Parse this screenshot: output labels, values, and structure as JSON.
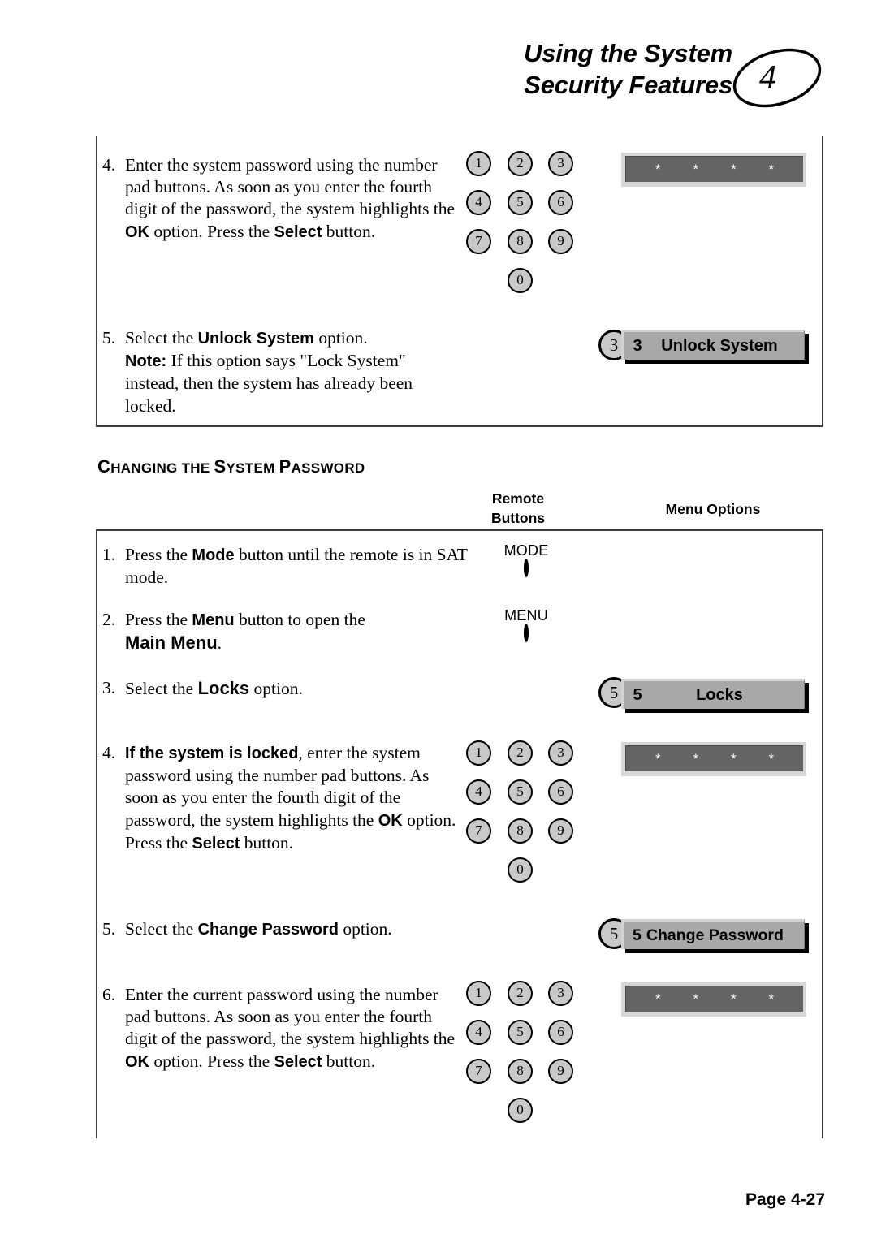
{
  "header": {
    "title_line1": "Using the System",
    "title_line2": "Security Features",
    "chapter_number": "4"
  },
  "section": {
    "heading_parts": [
      "C",
      "HANGING THE ",
      "S",
      "YSTEM ",
      "P",
      "ASSWORD"
    ],
    "heading_full": "CHANGING THE SYSTEM PASSWORD"
  },
  "column_headers": {
    "remote_line1": "Remote",
    "remote_line2": "Buttons",
    "menu": "Menu Options"
  },
  "keypad": {
    "row1": [
      "1",
      "2",
      "3"
    ],
    "row2": [
      "4",
      "5",
      "6"
    ],
    "row3": [
      "7",
      "8",
      "9"
    ],
    "row4": [
      "0"
    ]
  },
  "password_field": {
    "masked_chars": [
      "*",
      "*",
      "*",
      "*"
    ]
  },
  "box_unlock": {
    "steps": [
      {
        "number": "4.",
        "text_pre": "Enter the system password using the number pad buttons.  As soon as you enter the fourth digit of the password, the system highlights the ",
        "ui1": "OK",
        "text_mid": " option.  Press the ",
        "ui2": "Select",
        "text_post": " button."
      },
      {
        "number": "5.",
        "text_pre": "Select the ",
        "ui1": "Unlock System",
        "text_mid": " option.",
        "note_label": "Note:",
        "note_text": "  If this option says \"Lock System\" instead, then the system has already been locked."
      }
    ],
    "remote_button_5": "3",
    "menu_option": {
      "number": "3",
      "label": "Unlock System"
    }
  },
  "box_change": {
    "steps": [
      {
        "number": "1.",
        "text_pre": "Press the ",
        "ui1": "Mode",
        "text_post": " button until the remote is in SAT mode.",
        "remote_label": "MODE"
      },
      {
        "number": "2.",
        "text_pre": "Press the ",
        "ui1": "Menu",
        "text_mid": " button to open the ",
        "ui2": "Main Menu",
        "text_post": ".",
        "remote_label": "MENU"
      },
      {
        "number": "3.",
        "text_pre": "Select the ",
        "ui1": "Locks",
        "text_post": " option.",
        "remote_button": "5",
        "menu_option": {
          "number": "5",
          "label": "Locks"
        }
      },
      {
        "number": "4.",
        "ui_lead": "If the system is locked",
        "text_pre": ", enter the system password using the number pad buttons.  As soon as you enter the fourth digit of the password, the system highlights the ",
        "ui1": "OK",
        "text_mid": " option.  Press the ",
        "ui2": "Select",
        "text_post": " button."
      },
      {
        "number": "5.",
        "text_pre": "Select the ",
        "ui1": "Change Password",
        "text_post": " option.",
        "remote_button": "5",
        "menu_option": {
          "number": "5",
          "label": "Change Password"
        }
      },
      {
        "number": "6.",
        "text_pre": "Enter the current password using the number pad buttons.  As soon as you enter the fourth digit of the password, the system highlights the ",
        "ui1": "OK",
        "text_mid": " option.  Press the ",
        "ui2": "Select",
        "text_post": " button."
      }
    ]
  },
  "footer": {
    "page_number": "Page 4-27"
  }
}
